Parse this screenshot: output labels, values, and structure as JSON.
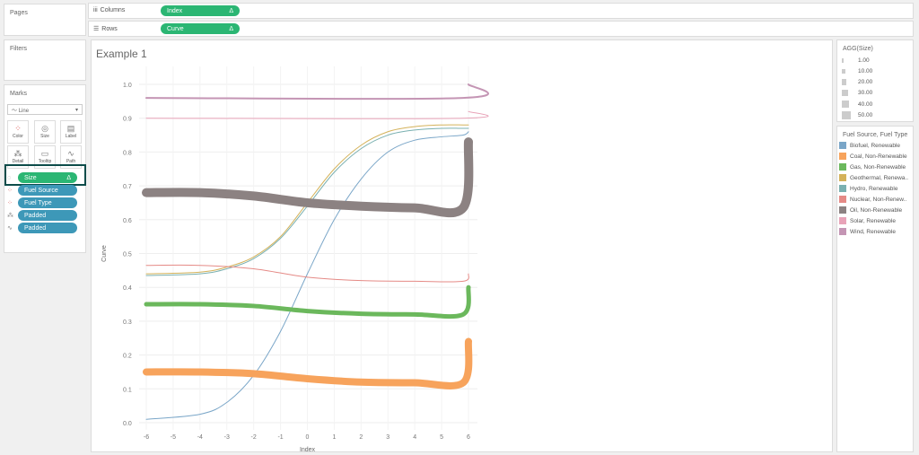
{
  "pages": {
    "title": "Pages"
  },
  "filters": {
    "title": "Filters"
  },
  "marks": {
    "title": "Marks",
    "mark_type": "Line",
    "buttons": [
      {
        "label": "Color",
        "icon": "color-icon"
      },
      {
        "label": "Size",
        "icon": "size-icon"
      },
      {
        "label": "Label",
        "icon": "label-icon"
      },
      {
        "label": "Detail",
        "icon": "detail-icon"
      },
      {
        "label": "Tooltip",
        "icon": "tooltip-icon"
      },
      {
        "label": "Path",
        "icon": "path-icon"
      }
    ],
    "fields": [
      {
        "label": "Size",
        "delta": "Δ",
        "kind": "green",
        "icon": "size-icon"
      },
      {
        "label": "Fuel Source",
        "kind": "blue",
        "icon": "color-icon"
      },
      {
        "label": "Fuel Type",
        "kind": "blue",
        "icon": "color-icon"
      },
      {
        "label": "Padded",
        "kind": "blue",
        "icon": "detail-icon"
      },
      {
        "label": "Padded",
        "kind": "blue",
        "icon": "path-icon"
      }
    ]
  },
  "shelves": {
    "columns_label": "Columns",
    "columns_pill": "Index",
    "rows_label": "Rows",
    "rows_pill": "Curve",
    "delta": "Δ"
  },
  "size_legend": {
    "title": "AGG(Size)",
    "items": [
      "1.00",
      "10.00",
      "20.00",
      "30.00",
      "40.00",
      "50.00"
    ]
  },
  "color_legend": {
    "title": "Fuel Source, Fuel Type",
    "items": [
      {
        "label": "Biofuel, Renewable",
        "color": "#7aa6c8"
      },
      {
        "label": "Coal, Non-Renewable",
        "color": "#f7a35c"
      },
      {
        "label": "Gas, Non-Renewable",
        "color": "#6bb85c"
      },
      {
        "label": "Geothermal, Renewa..",
        "color": "#d4b25a"
      },
      {
        "label": "Hydro, Renewable",
        "color": "#7ab0b0"
      },
      {
        "label": "Nuclear, Non-Renew..",
        "color": "#e58a86"
      },
      {
        "label": "Oil, Non-Renewable",
        "color": "#8c8282"
      },
      {
        "label": "Solar, Renewable",
        "color": "#e8a3b8"
      },
      {
        "label": "Wind, Renewable",
        "color": "#c495b4"
      }
    ]
  },
  "chart_data": {
    "type": "line",
    "title": "Example 1",
    "xlabel": "Index",
    "ylabel": "Curve",
    "x_ticks": [
      "-6",
      "-5",
      "-4",
      "-3",
      "-2",
      "-1",
      "0",
      "1",
      "2",
      "3",
      "4",
      "5",
      "6"
    ],
    "y_ticks": [
      "0.0",
      "0.1",
      "0.2",
      "0.3",
      "0.4",
      "0.5",
      "0.6",
      "0.7",
      "0.8",
      "0.9",
      "1.0"
    ],
    "xlim": [
      -6,
      6
    ],
    "ylim": [
      0,
      1
    ],
    "grid": true,
    "series": [
      {
        "name": "Biofuel, Renewable",
        "color": "#7aa6c8",
        "weight": 1,
        "x": [
          -6,
          -4,
          -3,
          -2,
          -1,
          0,
          1,
          2,
          3,
          4,
          5,
          5.8,
          6
        ],
        "y": [
          0.01,
          0.025,
          0.06,
          0.14,
          0.27,
          0.44,
          0.6,
          0.72,
          0.8,
          0.835,
          0.845,
          0.85,
          0.86
        ]
      },
      {
        "name": "Coal, Non-Renewable",
        "color": "#f7a35c",
        "weight": 8,
        "x": [
          -6,
          -4,
          -2,
          0,
          2,
          4,
          5.8,
          6
        ],
        "y": [
          0.15,
          0.15,
          0.145,
          0.13,
          0.12,
          0.118,
          0.118,
          0.24
        ]
      },
      {
        "name": "Gas, Non-Renewable",
        "color": "#6bb85c",
        "weight": 5,
        "x": [
          -6,
          -4,
          -2,
          0,
          2,
          4,
          5.8,
          6
        ],
        "y": [
          0.35,
          0.35,
          0.345,
          0.33,
          0.322,
          0.32,
          0.32,
          0.4
        ]
      },
      {
        "name": "Geothermal, Renewa..",
        "color": "#d4b25a",
        "weight": 1,
        "x": [
          -6,
          -4,
          -3,
          -2,
          -1,
          0,
          1,
          2,
          3,
          4,
          5,
          5.8,
          6
        ],
        "y": [
          0.44,
          0.445,
          0.46,
          0.49,
          0.55,
          0.65,
          0.75,
          0.82,
          0.86,
          0.875,
          0.88,
          0.88,
          0.88
        ]
      },
      {
        "name": "Hydro, Renewable",
        "color": "#7ab0b0",
        "weight": 1,
        "x": [
          -6,
          -4,
          -3,
          -2,
          -1,
          0,
          1,
          2,
          3,
          4,
          5,
          5.8,
          6
        ],
        "y": [
          0.435,
          0.44,
          0.455,
          0.485,
          0.545,
          0.64,
          0.74,
          0.81,
          0.85,
          0.865,
          0.87,
          0.87,
          0.87
        ]
      },
      {
        "name": "Nuclear, Non-Renew..",
        "color": "#e58a86",
        "weight": 1,
        "x": [
          -6,
          -4,
          -2,
          0,
          2,
          4,
          5.8,
          6
        ],
        "y": [
          0.465,
          0.465,
          0.455,
          0.43,
          0.42,
          0.418,
          0.418,
          0.44
        ]
      },
      {
        "name": "Oil, Non-Renewable",
        "color": "#8c8282",
        "weight": 10,
        "x": [
          -6,
          -4,
          -2,
          0,
          2,
          4,
          5.8,
          6
        ],
        "y": [
          0.68,
          0.68,
          0.67,
          0.65,
          0.64,
          0.635,
          0.635,
          0.83
        ]
      },
      {
        "name": "Solar, Renewable",
        "color": "#e8a3b8",
        "weight": 1,
        "x": [
          -6,
          5.8,
          6
        ],
        "y": [
          0.9,
          0.9,
          0.92
        ]
      },
      {
        "name": "Wind, Renewable",
        "color": "#c495b4",
        "weight": 2,
        "x": [
          -6,
          5.8,
          6
        ],
        "y": [
          0.96,
          0.96,
          1.0
        ]
      }
    ]
  }
}
